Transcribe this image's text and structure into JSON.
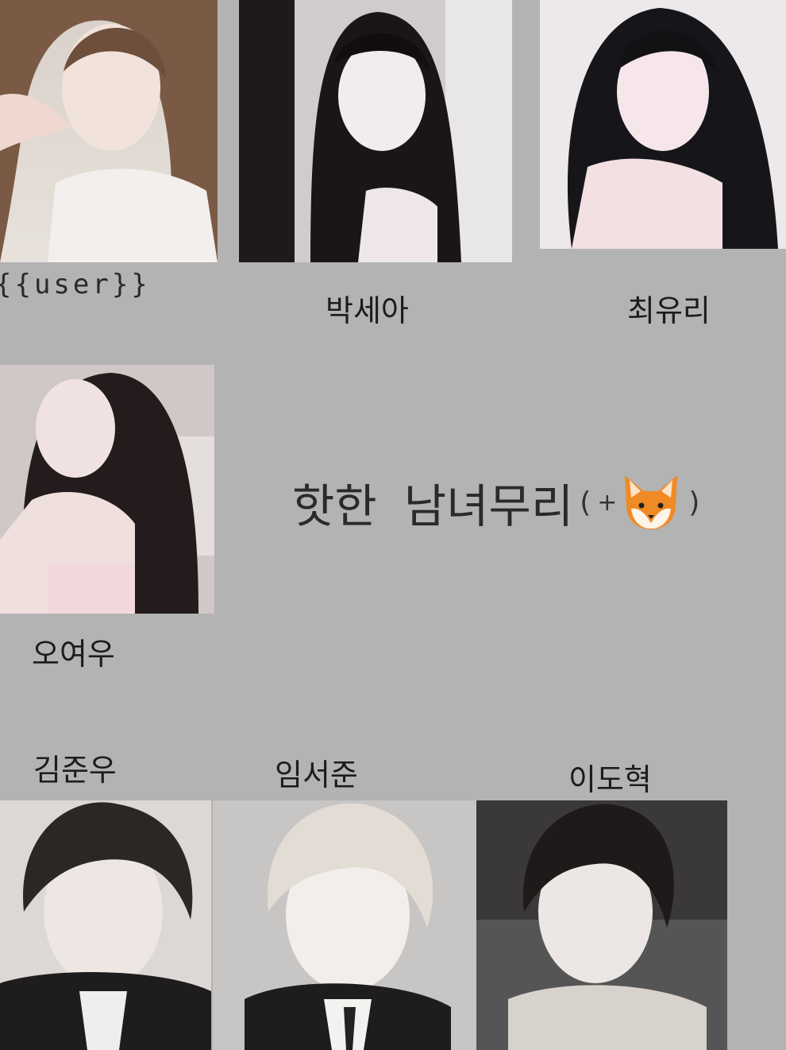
{
  "title": {
    "main": "핫한",
    "second": "남녀무리",
    "paren_open": "(",
    "plus": "+",
    "paren_close": ")",
    "emoji_icon": "fox-face-icon"
  },
  "characters": [
    {
      "id": "user",
      "label": "{{user}}",
      "hair": "#7a5a45"
    },
    {
      "id": "seah",
      "label": "박세아",
      "hair": "#1a1618"
    },
    {
      "id": "yuri",
      "label": "최유리",
      "hair": "#16161a"
    },
    {
      "id": "yeowoo",
      "label": "오여우",
      "hair": "#241c1c"
    },
    {
      "id": "junwoo",
      "label": "김준우",
      "hair": "#2a2724"
    },
    {
      "id": "seojun",
      "label": "임서준",
      "hair": "#e2dcd4"
    },
    {
      "id": "dohyuk",
      "label": "이도혁",
      "hair": "#1e1a1a"
    }
  ],
  "colors": {
    "background": "#b3b3b3",
    "text": "#1c1c1c",
    "fox_orange": "#f08a24"
  }
}
